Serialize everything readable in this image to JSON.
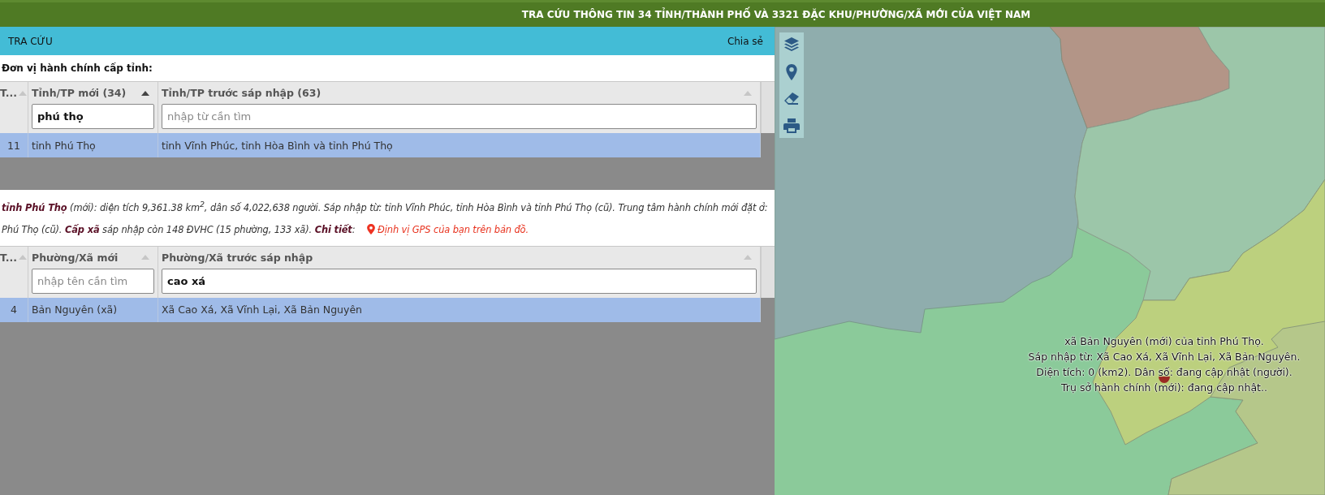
{
  "title": "TRA CỨU THÔNG TIN 34 TỈNH/THÀNH PHỐ VÀ 3321 ĐẶC KHU/PHƯỜNG/XÃ MỚI CỦA VIỆT NAM",
  "nav": {
    "title": "TRA CỨU",
    "share": "Chia sẻ"
  },
  "province_heading": "Đơn vị hành chính cấp tỉnh:",
  "province_table": {
    "columns": [
      {
        "label": "T...",
        "sorted": false
      },
      {
        "label": "Tỉnh/TP mới (34)",
        "sorted": true,
        "filter": {
          "value": "phú thọ"
        }
      },
      {
        "label": "Tỉnh/TP trước sáp nhập (63)",
        "sorted": false,
        "filter": {
          "placeholder": "nhập từ cần tìm"
        }
      }
    ],
    "rows": [
      {
        "cells": [
          "11",
          "tỉnh Phú Thọ",
          "tỉnh Vĩnh Phúc, tỉnh Hòa Bình và tỉnh Phú Thọ"
        ],
        "selected": true
      }
    ]
  },
  "info": {
    "text": "**tỉnh Phú Thọ** (mới): diện tích 9,361.38 km$^{2}$, dân số 4,022,638 người. Sáp nhập từ: tỉnh Vĩnh Phúc, tỉnh Hòa Bình và tỉnh Phú Thọ (cũ). Trung tâm hành chính mới đặt ở: Phú Thọ (cũ). **Cấp xã** sáp nhập còn 148 ĐVHC (15 phường, 133 xã). **Chi tiết**:",
    "link": "Định vị GPS của bạn trên bản đồ."
  },
  "ward_table": {
    "columns": [
      {
        "label": "T...",
        "sorted": false
      },
      {
        "label": "Phường/Xã mới",
        "sorted": false,
        "filter": {
          "placeholder": "nhập tên cần tìm"
        }
      },
      {
        "label": "Phường/Xã trước sáp nhập",
        "sorted": false,
        "filter": {
          "value": "cao xá"
        }
      }
    ],
    "rows": [
      {
        "cells": [
          "4",
          "Bản Nguyên (xã)",
          "Xã Cao Xá, Xã Vĩnh Lại, Xã Bản Nguyên"
        ],
        "selected": true
      }
    ]
  },
  "map": {
    "popup": [
      "xã Bản Nguyên (mới) của tỉnh Phú Thọ.",
      "Sáp nhập từ: Xã Cao Xá, Xã Vĩnh Lại, Xã Bản Nguyên.",
      "Diện tích: 0 (km2). Dân số: đang cập nhật (người).",
      "Trụ sở hành chính (mới): đang cập nhật.."
    ]
  }
}
